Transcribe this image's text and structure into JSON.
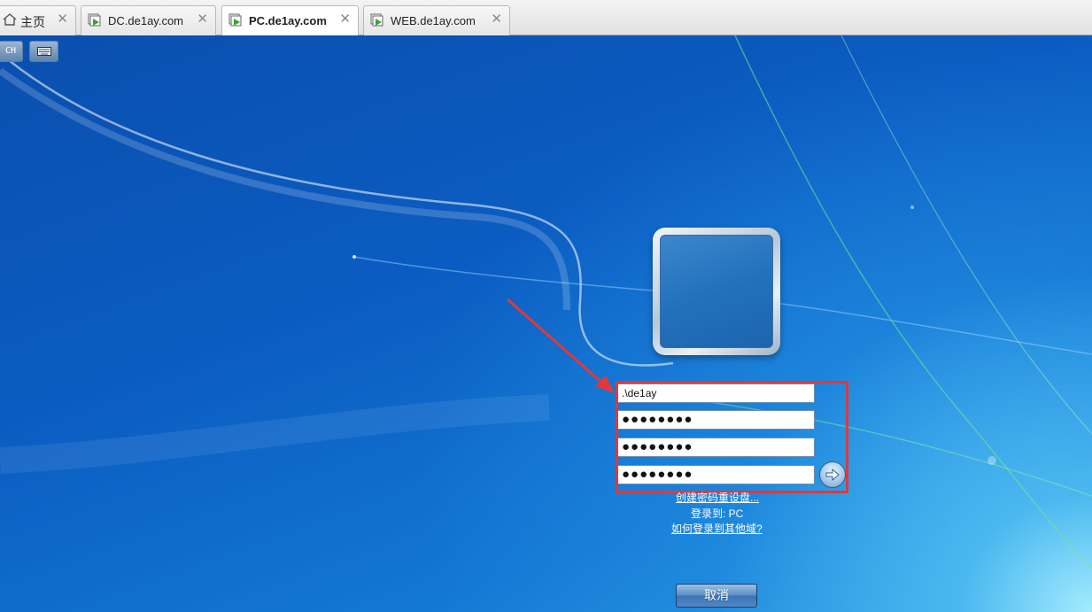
{
  "tabs": [
    {
      "label": "主页",
      "icon": "home-icon",
      "active": false
    },
    {
      "label": "DC.de1ay.com",
      "icon": "vm-running-icon",
      "active": false
    },
    {
      "label": "PC.de1ay.com",
      "icon": "vm-running-icon",
      "active": true
    },
    {
      "label": "WEB.de1ay.com",
      "icon": "vm-running-icon",
      "active": false
    }
  ],
  "toolbar": {
    "language_label": "CH",
    "keyboard_icon": "keyboard-icon"
  },
  "login": {
    "username_value": ".\\de1ay",
    "password_mask": "●●●●●●●●",
    "new_password_mask": "●●●●●●●●",
    "confirm_password_mask": "●●●●●●●●",
    "submit_icon": "arrow-right-icon",
    "reset_disk_link": "创建密码重设盘...",
    "login_to_text": "登录到: PC",
    "other_domain_link": "如何登录到其他域?",
    "cancel_label": "取消"
  },
  "colors": {
    "highlight": "#e2383a",
    "desktop_blue": "#0b5cc2"
  }
}
